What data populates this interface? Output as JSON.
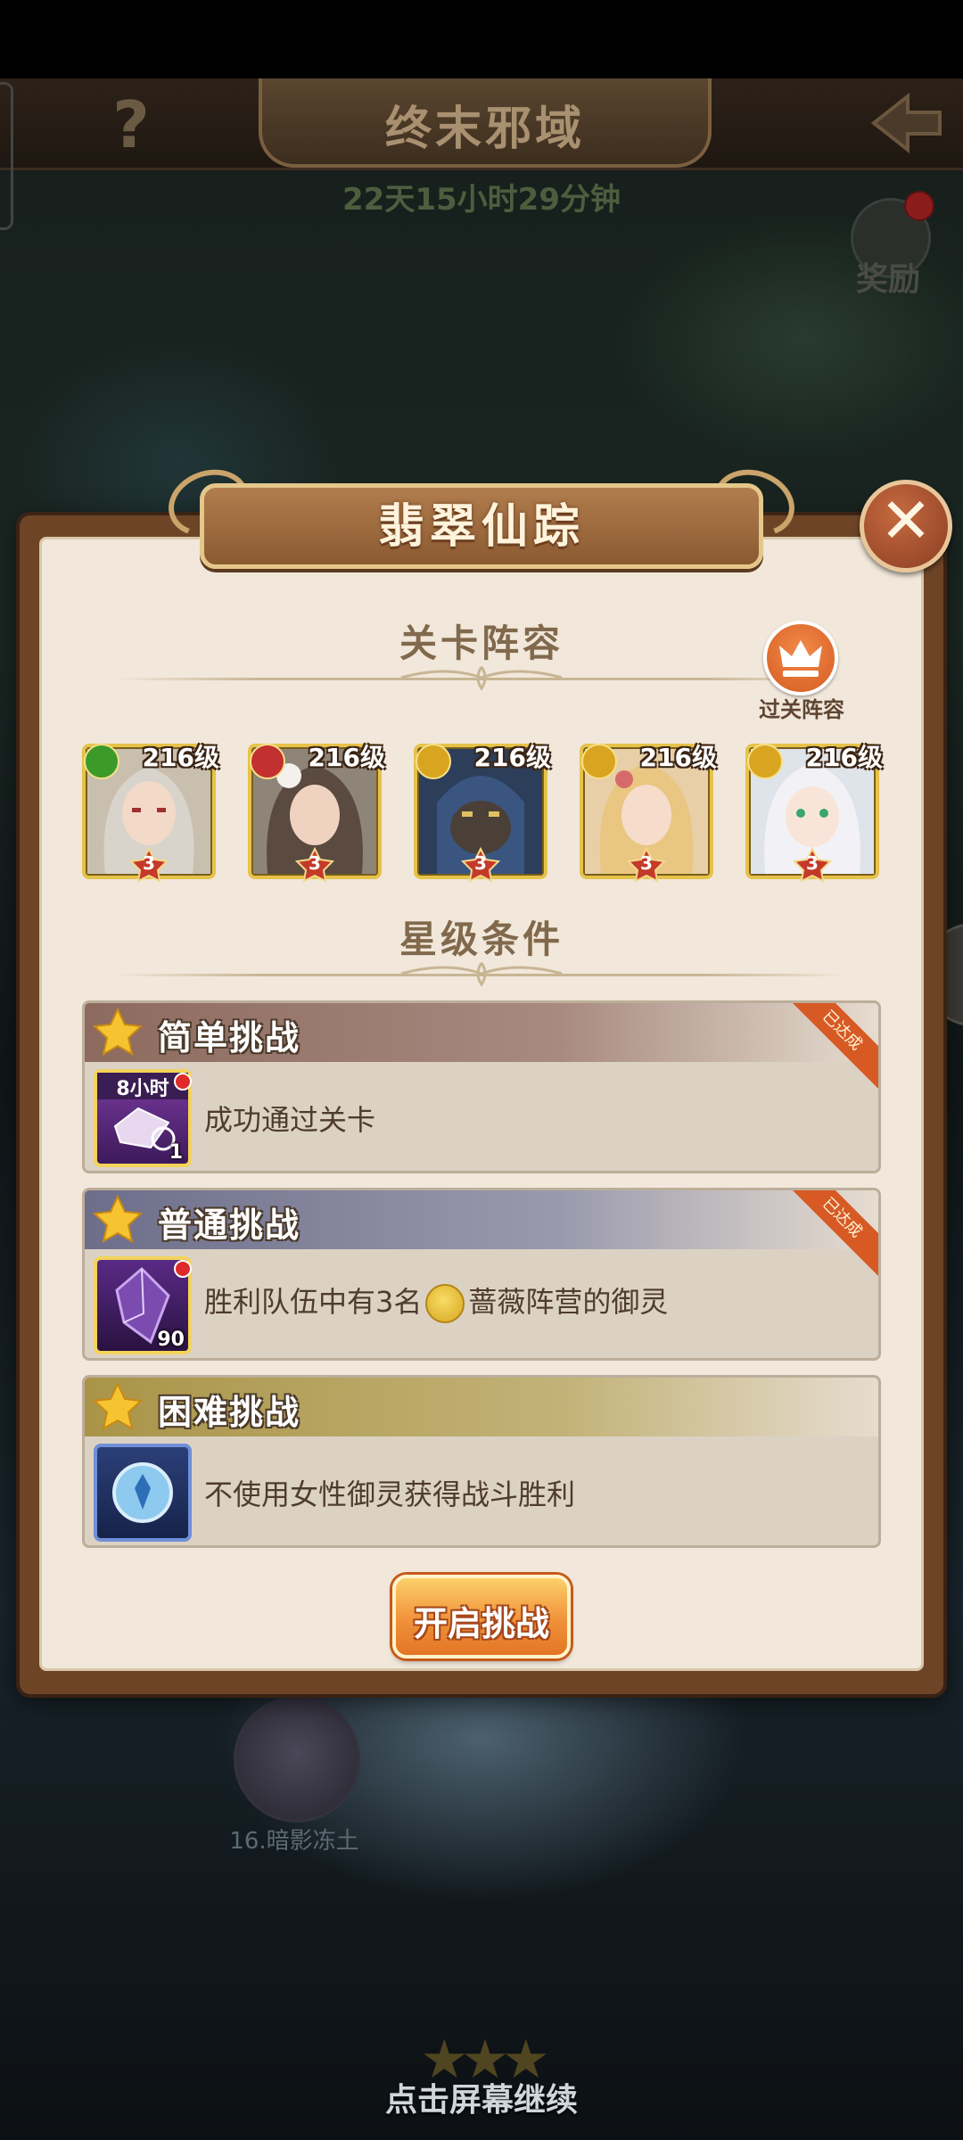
{
  "game": {
    "title": "终末邪域",
    "timer": "22天15小时29分钟",
    "help_glyph": "?",
    "reward_label": "奖励"
  },
  "map": {
    "stage_label": "16.暗影冻土",
    "continue_hint": "点击屏幕继续",
    "stars": "★★★"
  },
  "dialog": {
    "title": "翡翠仙踪",
    "close_glyph": "✕",
    "lineup_title": "关卡阵容",
    "clear_lineup_label": "过关阵容",
    "star_conditions_title": "星级条件",
    "start_button": "开启挑战",
    "heroes": [
      {
        "level": "216级",
        "stars": "3",
        "faction": "nature",
        "faction_color": "#3c9a2a",
        "portrait": "silver-haired-woman"
      },
      {
        "level": "216级",
        "stars": "3",
        "faction": "fire",
        "faction_color": "#c23030",
        "portrait": "dark-haired-woman"
      },
      {
        "level": "216级",
        "stars": "3",
        "faction": "rose",
        "faction_color": "#d9a520",
        "portrait": "armored-beast"
      },
      {
        "level": "216级",
        "stars": "3",
        "faction": "rose",
        "faction_color": "#d9a520",
        "portrait": "blonde-woman"
      },
      {
        "level": "216级",
        "stars": "3",
        "faction": "rose",
        "faction_color": "#d9a520",
        "portrait": "white-haired-girl"
      }
    ],
    "challenges": [
      {
        "name": "简单挑战",
        "desc": "成功通过关卡",
        "status": "已达成",
        "reward_label": "8小时",
        "reward_count": "1",
        "header_color": "#8d6a5e"
      },
      {
        "name": "普通挑战",
        "desc_before": "胜利队伍中有3名",
        "desc_after": "蔷薇阵营的御灵",
        "status": "已达成",
        "reward_count": "90",
        "header_color": "#6d6e8a"
      },
      {
        "name": "困难挑战",
        "desc": "不使用女性御灵获得战斗胜利",
        "header_color": "#a99448"
      }
    ]
  }
}
